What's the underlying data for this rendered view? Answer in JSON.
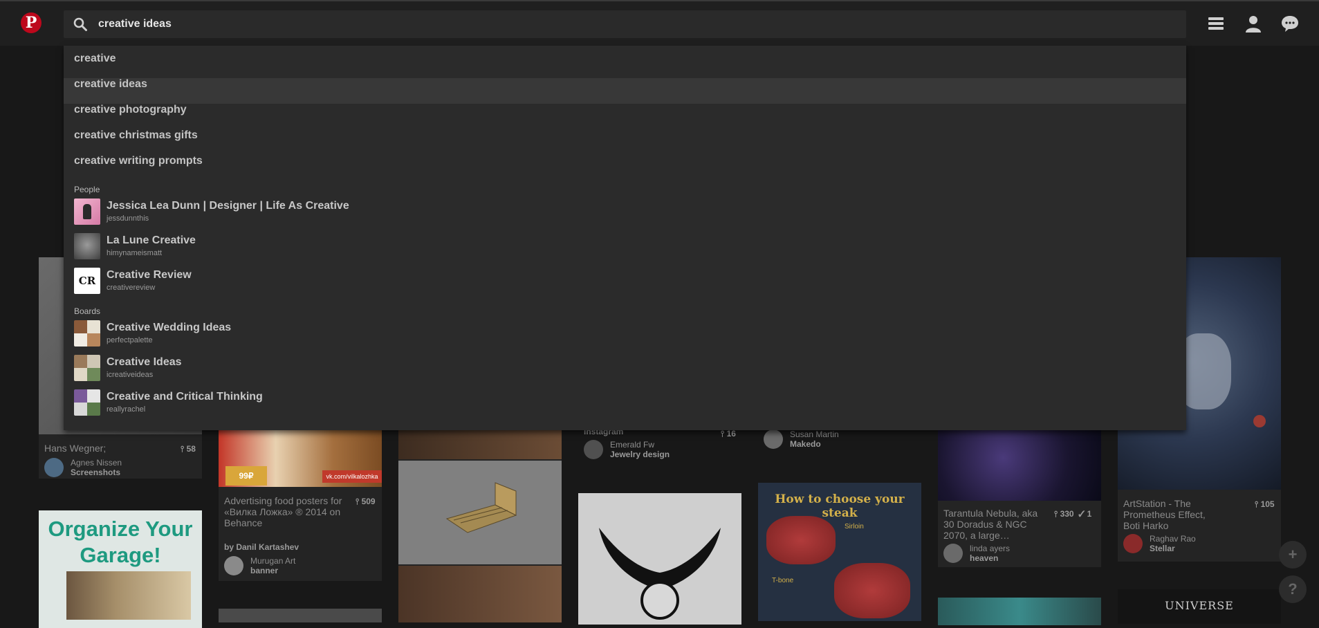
{
  "search": {
    "value": "creative ideas"
  },
  "suggestions": [
    {
      "label": "creative"
    },
    {
      "label": "creative ideas"
    },
    {
      "label": "creative photography"
    },
    {
      "label": "creative christmas gifts"
    },
    {
      "label": "creative writing prompts"
    }
  ],
  "people_label": "People",
  "people": [
    {
      "name": "Jessica Lea Dunn | Designer | Life As Creative",
      "handle": "jessdunnthis"
    },
    {
      "name": "La Lune Creative",
      "handle": "himynameismatt"
    },
    {
      "name": "Creative Review",
      "handle": "creativereview",
      "logo": "CR"
    }
  ],
  "boards_label": "Boards",
  "boards": [
    {
      "name": "Creative Wedding Ideas",
      "owner": "perfectpalette"
    },
    {
      "name": "Creative Ideas",
      "owner": "icreativeideas"
    },
    {
      "name": "Creative and Critical Thinking",
      "owner": "reallyrachel"
    }
  ],
  "pins": {
    "wegner": {
      "title": "Hans Wegner;",
      "count": "58",
      "user": "Agnes Nissen",
      "board": "Screenshots"
    },
    "garage": {
      "title_line1": "Organize Your",
      "title_line2": "Garage!"
    },
    "food": {
      "title": "Advertising food posters for «Вилка Ложка» ® 2014 on Behance",
      "count": "509",
      "by": "by Danil Kartashev",
      "user": "Murugan Art",
      "board": "banner",
      "price": "99₽",
      "url": "vk.com/vilkalozhka"
    },
    "jewelry": {
      "title": "instagram",
      "count": "16",
      "user": "Emerald Fw",
      "board": "Jewelry design"
    },
    "makedo": {
      "user": "Susan Martin",
      "board": "Makedo"
    },
    "steak": {
      "title": "How to choose your steak",
      "cut1": "Sirloin",
      "cut2": "T-bone"
    },
    "nebula": {
      "title": "Tarantula Nebula, aka 30 Doradus & NGC 2070, a large…",
      "count": "330",
      "checks": "1",
      "user": "linda ayers",
      "board": "heaven"
    },
    "artstation": {
      "title": "ArtStation - The Prometheus Effect, Boti Harko",
      "count": "105",
      "user": "Raghav Rao",
      "board": "Stellar"
    },
    "universe": {
      "title": "UNIVERSE"
    }
  },
  "fab": {
    "add": "+",
    "help": "?"
  }
}
